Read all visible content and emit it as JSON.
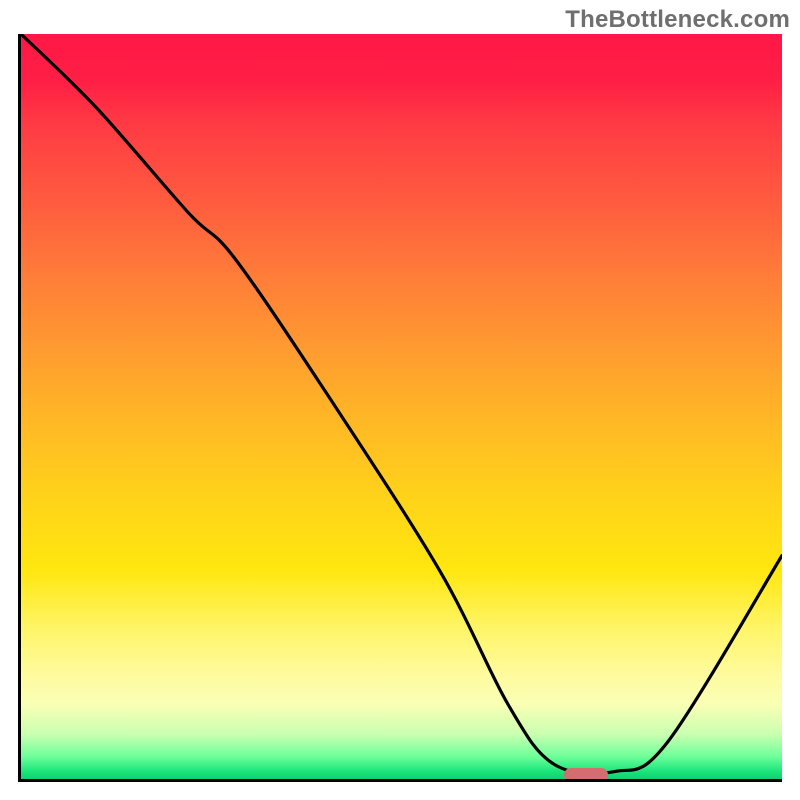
{
  "watermark": "TheBottleneck.com",
  "chart_data": {
    "type": "line",
    "title": "",
    "xlabel": "",
    "ylabel": "",
    "xlim": [
      0,
      100
    ],
    "ylim": [
      0,
      100
    ],
    "grid": false,
    "legend": false,
    "series": [
      {
        "name": "bottleneck-curve",
        "x": [
          0,
          10,
          22,
          28,
          40,
          55,
          64,
          70,
          78,
          85,
          100
        ],
        "y": [
          100,
          90,
          76,
          70,
          52,
          28,
          10,
          2,
          1,
          5,
          30
        ]
      }
    ],
    "marker": {
      "x": 74,
      "y": 1,
      "color": "#d56c6f"
    },
    "gradient_colors": {
      "top": "#ff1846",
      "mid": "#ffd21a",
      "bottom": "#14cf6f"
    }
  }
}
